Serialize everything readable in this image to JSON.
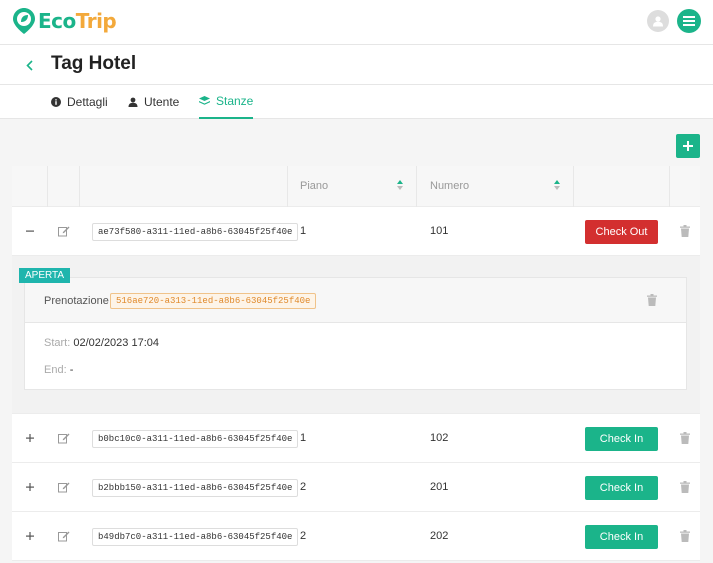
{
  "app": {
    "logo_part1": "Eco",
    "logo_part2": "Trip"
  },
  "page": {
    "title": "Tag Hotel"
  },
  "tabs": [
    {
      "label": "Dettagli",
      "icon": "info-icon",
      "active": false
    },
    {
      "label": "Utente",
      "icon": "user-icon",
      "active": false
    },
    {
      "label": "Stanze",
      "icon": "layers-icon",
      "active": true
    }
  ],
  "table": {
    "columns": {
      "piano": "Piano",
      "numero": "Numero"
    },
    "rows": [
      {
        "id": "ae73f580-a311-11ed-a8b6-63045f25f40e",
        "piano": "1",
        "numero": "101",
        "action": "Check Out",
        "expanded": true
      },
      {
        "id": "b0bc10c0-a311-11ed-a8b6-63045f25f40e",
        "piano": "1",
        "numero": "102",
        "action": "Check In",
        "expanded": false
      },
      {
        "id": "b2bbb150-a311-11ed-a8b6-63045f25f40e",
        "piano": "2",
        "numero": "201",
        "action": "Check In",
        "expanded": false
      },
      {
        "id": "b49db7c0-a311-11ed-a8b6-63045f25f40e",
        "piano": "2",
        "numero": "202",
        "action": "Check In",
        "expanded": false
      }
    ]
  },
  "booking": {
    "status": "APERTA",
    "label": "Prenotazione",
    "id": "516ae720-a313-11ed-a8b6-63045f25f40e",
    "start_label": "Start:",
    "start_value": "02/02/2023 17:04",
    "end_label": "End:",
    "end_value": "-"
  },
  "colors": {
    "primary": "#1bb48a",
    "danger": "#d32f2f",
    "accent": "#f3a93b",
    "badge": "#1fb5ad"
  }
}
